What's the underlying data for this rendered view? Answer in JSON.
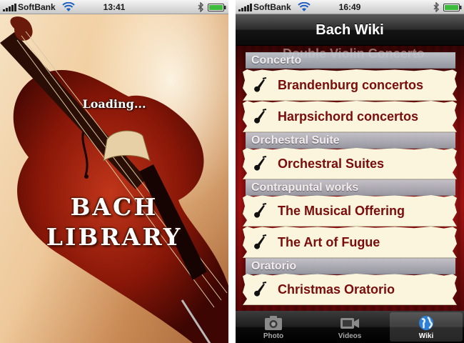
{
  "screens": {
    "left": {
      "status": {
        "carrier": "SoftBank",
        "time": "13:41"
      },
      "splash": {
        "loading": "Loading...",
        "title_line1": "BACH",
        "title_line2": "LIBRARY"
      }
    },
    "right": {
      "status": {
        "carrier": "SoftBank",
        "time": "16:49"
      },
      "navbar": {
        "title": "Bach Wiki"
      },
      "ghost_text": "Double Violin Concerto",
      "sections": [
        {
          "header": "Concerto",
          "items": [
            "Brandenburg concertos",
            "Harpsichord concertos"
          ]
        },
        {
          "header": "Orchestral Suite",
          "items": [
            "Orchestral Suites"
          ]
        },
        {
          "header": "Contrapuntal works",
          "items": [
            "The Musical Offering",
            "The Art of Fugue"
          ]
        },
        {
          "header": "Oratorio",
          "items": [
            "Christmas Oratorio"
          ]
        }
      ],
      "tabbar": {
        "tabs": [
          {
            "label": "Photo",
            "icon": "camera-icon",
            "active": false
          },
          {
            "label": "Videos",
            "icon": "video-camera-icon",
            "active": false
          },
          {
            "label": "Wiki",
            "icon": "globe-icon",
            "active": true
          }
        ]
      }
    }
  },
  "colors": {
    "row_text": "#7a0c0c",
    "row_background": "#fbf5dd",
    "section_header": "#9aa3ad",
    "curtain": "#a51212"
  }
}
